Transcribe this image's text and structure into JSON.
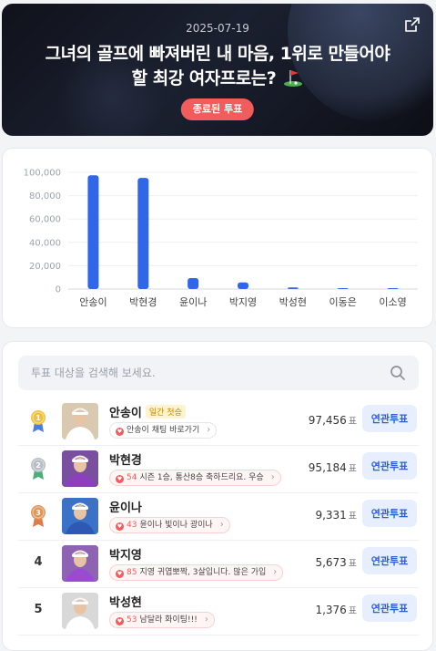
{
  "hero": {
    "date": "2025-07-19",
    "title_line1": "그녀의 골프에 빠져버린 내 마음, 1위로 만들어야",
    "title_line2": "할 최강 여자프로는?",
    "status_badge": "종료된 투표"
  },
  "chart_data": {
    "type": "bar",
    "categories": [
      "안송이",
      "박현경",
      "윤이나",
      "박지영",
      "박성현",
      "이동은",
      "이소영"
    ],
    "values": [
      97456,
      95184,
      9331,
      5673,
      1376,
      500,
      300
    ],
    "y_ticks": [
      "0",
      "20,000",
      "40,000",
      "60,000",
      "80,000",
      "100,000"
    ],
    "ylim": [
      0,
      100000
    ],
    "grid": true,
    "bar_color": "#2f67e8"
  },
  "search": {
    "placeholder": "투표 대상을 검색해 보세요."
  },
  "vote_unit": "표",
  "related_vote_label": "연관투표",
  "candidates": [
    {
      "rank": "1",
      "name": "안송이",
      "tag": "일간 첫승",
      "comment_count": "",
      "comment": "안송이 채팅 바로가기",
      "votes": "97,456",
      "medal_color": "#f0c23b"
    },
    {
      "rank": "2",
      "name": "박현경",
      "tag": "",
      "comment_count": "54",
      "comment": "시즌 1승, 통산8승 축하드리요. 우승",
      "votes": "95,184",
      "medal_color": "#b8bec8"
    },
    {
      "rank": "3",
      "name": "윤이나",
      "tag": "",
      "comment_count": "43",
      "comment": "윤이나 빛이나 광이나",
      "votes": "9,331",
      "medal_color": "#e0975a"
    },
    {
      "rank": "4",
      "name": "박지영",
      "tag": "",
      "comment_count": "85",
      "comment": "지영 귀엽뽀짝, 3살입니다. 많은 가입",
      "votes": "5,673",
      "medal_color": ""
    },
    {
      "rank": "5",
      "name": "박성현",
      "tag": "",
      "comment_count": "53",
      "comment": "남달라 화이팅!!!",
      "votes": "1,376",
      "medal_color": ""
    }
  ],
  "colors": {
    "accent": "#2f67e8",
    "badge_red": "#f25c5c",
    "related_btn_bg": "#e7efff"
  }
}
